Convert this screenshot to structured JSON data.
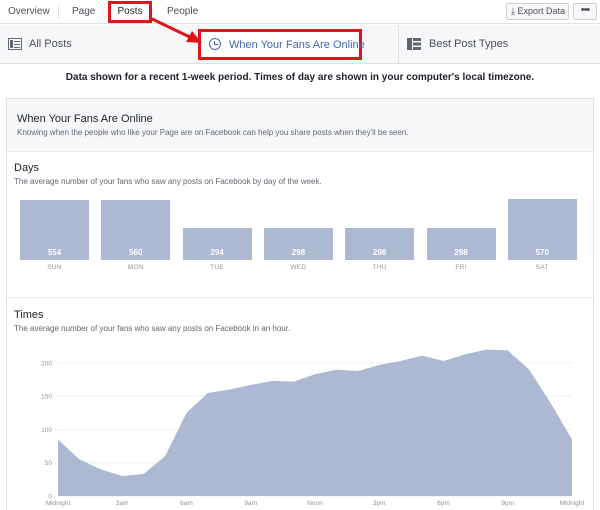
{
  "top_tabs": {
    "overview": "Overview",
    "page": "Page",
    "posts": "Posts",
    "people": "People"
  },
  "toolbar": {
    "export_label": "Export Data",
    "more_label": "•••"
  },
  "sub_nav": {
    "all_posts": "All Posts",
    "when_online": "When Your Fans Are Online",
    "best_types": "Best Post Types"
  },
  "note": "Data shown for a recent 1-week period. Times of day are shown in your computer's local timezone.",
  "card": {
    "title": "When Your Fans Are Online",
    "subtitle": "Knowing when the people who like your Page are on Facebook can help you share posts when they'll be seen.",
    "days": {
      "title": "Days",
      "subtitle": "The average number of your fans who saw any posts on Facebook by day of the week."
    },
    "times": {
      "title": "Times",
      "subtitle": "The average number of your fans who saw any posts on Facebook in an hour."
    }
  },
  "colors": {
    "highlight": "#e0141a",
    "bar": "#adb9d3",
    "link": "#4267b2"
  },
  "chart_data": [
    {
      "type": "bar",
      "title": "Days",
      "categories": [
        "SUN",
        "MON",
        "TUE",
        "WED",
        "THU",
        "FRI",
        "SAT"
      ],
      "values": [
        554,
        560,
        294,
        298,
        296,
        298,
        570
      ]
    },
    {
      "type": "area",
      "title": "Times",
      "x_tick_labels": [
        "Midnight",
        "3am",
        "6am",
        "9am",
        "Noon",
        "3pm",
        "6pm",
        "9pm",
        "Midnight"
      ],
      "y_ticks": [
        0,
        50,
        100,
        150,
        200
      ],
      "ylim": [
        0,
        215
      ],
      "x": [
        0,
        1,
        2,
        3,
        4,
        5,
        6,
        7,
        8,
        9,
        10,
        11,
        12,
        13,
        14,
        15,
        16,
        17,
        18,
        19,
        20,
        21,
        22,
        23,
        24
      ],
      "values": [
        85,
        55,
        40,
        30,
        33,
        60,
        125,
        155,
        160,
        167,
        173,
        172,
        183,
        190,
        188,
        197,
        203,
        211,
        203,
        213,
        220,
        219,
        190,
        140,
        85
      ]
    }
  ]
}
